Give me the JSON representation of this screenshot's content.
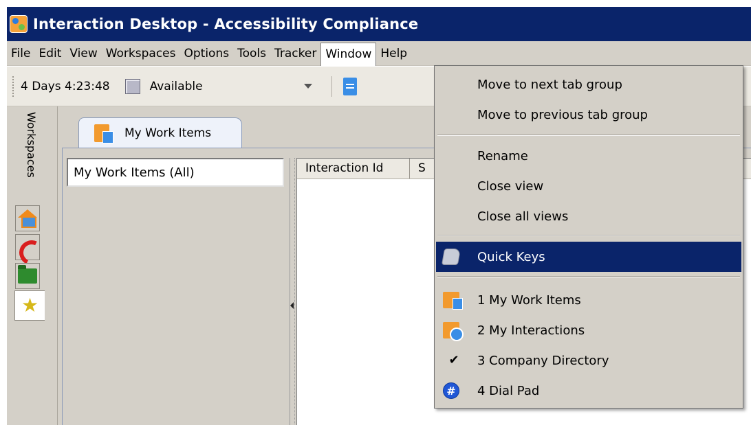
{
  "window": {
    "title": "Interaction Desktop - Accessibility Compliance"
  },
  "menubar": {
    "items": [
      "File",
      "Edit",
      "View",
      "Workspaces",
      "Options",
      "Tools",
      "Tracker",
      "Window",
      "Help"
    ],
    "active": "Window"
  },
  "toolbar": {
    "timer": "4 Days 4:23:48",
    "status": "Available"
  },
  "rail": {
    "label": "Workspaces"
  },
  "tab": {
    "label": "My Work Items"
  },
  "filter": {
    "label": "My Work Items (All)"
  },
  "grid": {
    "columns": [
      "Interaction Id",
      "S"
    ]
  },
  "window_menu": {
    "items": [
      {
        "label": "Move to next tab group"
      },
      {
        "label": "Move to previous tab group"
      },
      {
        "label": "Rename"
      },
      {
        "label": "Close view"
      },
      {
        "label": "Close all views"
      },
      {
        "label": "Quick Keys",
        "icon": "quick-keys-icon",
        "highlighted": true
      },
      {
        "label": "1 My Work Items",
        "icon": "work-items-icon"
      },
      {
        "label": "2 My Interactions",
        "icon": "interactions-icon"
      },
      {
        "label": "3 Company Directory",
        "icon": "check-icon"
      },
      {
        "label": "4 Dial Pad",
        "icon": "dial-pad-icon",
        "glyph": "#"
      }
    ]
  },
  "colors": {
    "titlebar": "#0a246a",
    "menu_highlight": "#0a246a",
    "chrome": "#d4d0c8"
  }
}
